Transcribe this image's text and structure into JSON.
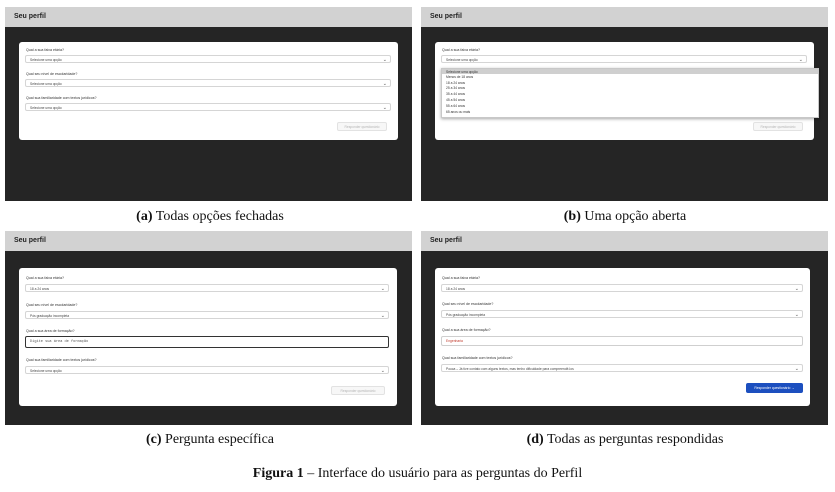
{
  "header_title": "Seu perfil",
  "panels": [
    {
      "caption_letter": "(a)",
      "caption_text": "Todas opções fechadas",
      "questions": [
        {
          "label": "Qual a sua faixa etária?",
          "value": "Selecione uma opção"
        },
        {
          "label": "Qual seu nível de escolaridade?",
          "value": "Selecione uma opção"
        },
        {
          "label": "Qual sua familiaridade com textos jurídicos?",
          "value": "Selecione uma opção"
        }
      ],
      "submit_label": "Responder questionário"
    },
    {
      "caption_letter": "(b)",
      "caption_text": "Uma opção aberta",
      "questions": [
        {
          "label": "Qual a sua faixa etária?",
          "value": "Selecione uma opção"
        }
      ],
      "dropdown_options": [
        "Selecione uma opção",
        "Menos de 18 anos",
        "18 a 24 anos",
        "25 a 34 anos",
        "35 a 44 anos",
        "45 a 54 anos",
        "55 a 64 anos",
        "65 anos ou mais"
      ],
      "submit_label": "Responder questionário"
    },
    {
      "caption_letter": "(c)",
      "caption_text": "Pergunta específica",
      "questions": [
        {
          "label": "Qual a sua faixa etária?",
          "value": "18 a 24 anos"
        },
        {
          "label": "Qual seu nível de escolaridade?",
          "value": "Pós graduação incompleta"
        },
        {
          "label": "Qual a sua área de formação?",
          "placeholder": "Digite sua área de formação"
        },
        {
          "label": "Qual sua familiaridade com textos jurídicos?",
          "value": "Selecione uma opção"
        }
      ],
      "submit_label": "Responder questionário"
    },
    {
      "caption_letter": "(d)",
      "caption_text": "Todas as perguntas respondidas",
      "questions": [
        {
          "label": "Qual a sua faixa etária?",
          "value": "18 a 24 anos"
        },
        {
          "label": "Qual seu nível de escolaridade?",
          "value": "Pós graduação incompleta"
        },
        {
          "label": "Qual a sua área de formação?",
          "value": "Engenharia"
        },
        {
          "label": "Qual sua familiaridade com textos jurídicos?",
          "value": "Pouca – Já tive contato com alguns textos, mas tenho dificuldade para compreendê-los"
        }
      ],
      "submit_label": "Responder questionário →"
    }
  ],
  "figure_caption_prefix": "Figura 1",
  "figure_caption_text": " – Interface do usuário para as perguntas do Perfil",
  "colors": {
    "submit_active": "#1c4fbf",
    "background_dark": "#252525",
    "header_bar": "#d2d2d2"
  }
}
